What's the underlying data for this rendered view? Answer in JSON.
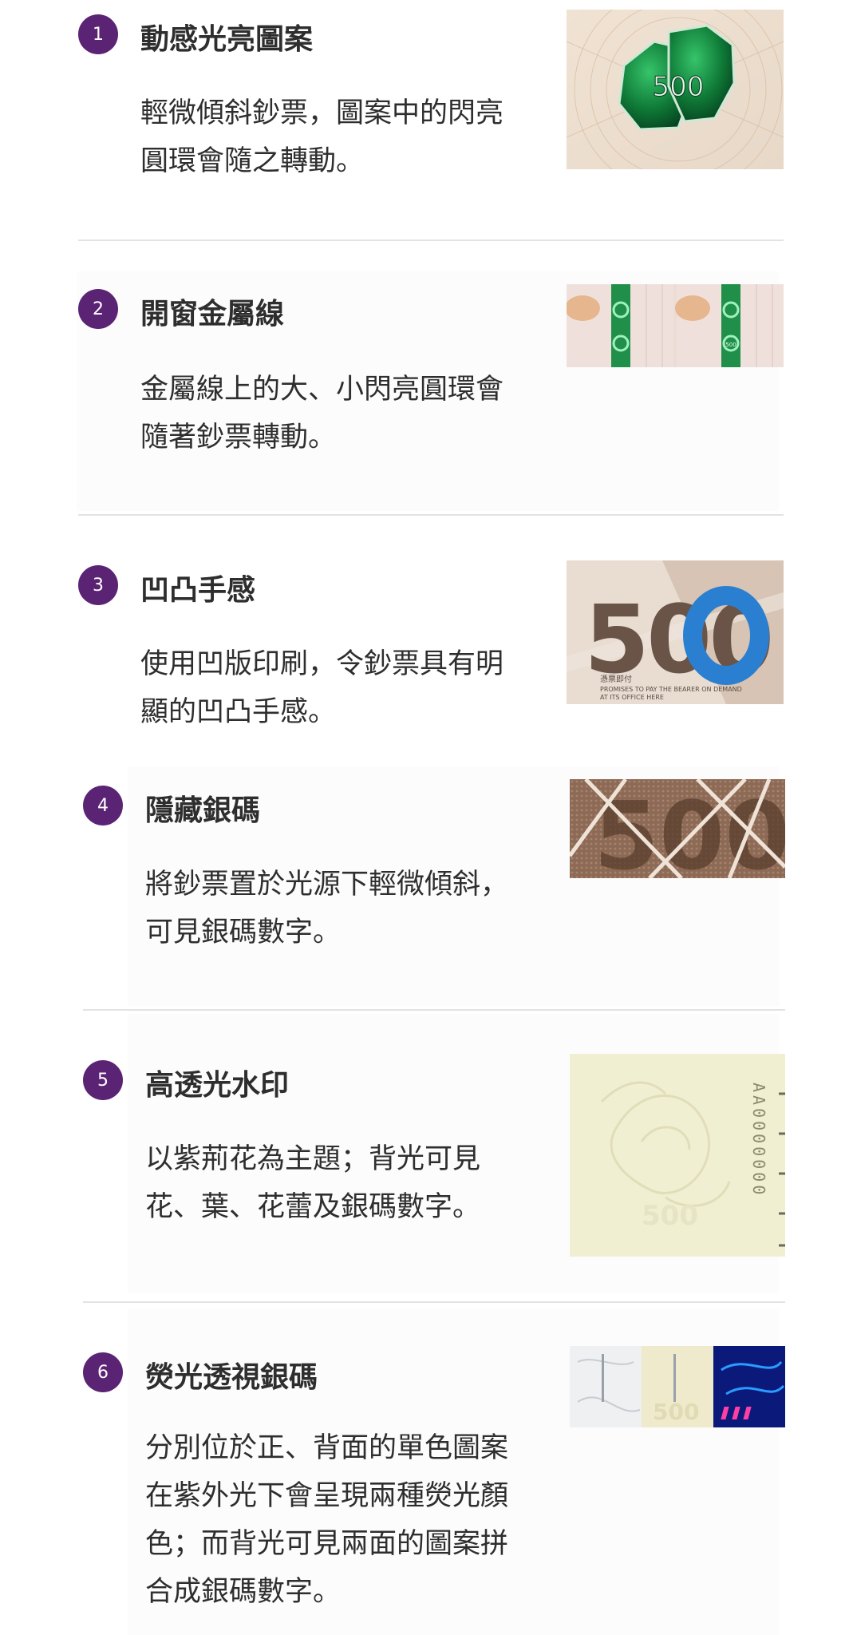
{
  "features": [
    {
      "number": "1",
      "title": "動感光亮圖案",
      "description": "輕微傾斜鈔票，圖案中的閃亮圓環會隨之轉動。",
      "image_text": "500"
    },
    {
      "number": "2",
      "title": "開窗金屬線",
      "description": "金屬線上的大、小閃亮圓環會隨著鈔票轉動。",
      "image_text": "500"
    },
    {
      "number": "3",
      "title": "凹凸手感",
      "description": "使用凹版印刷，令鈔票具有明顯的凹凸手感。",
      "image_text": "500",
      "image_caption_zh": "憑票即付",
      "image_caption_en_1": "PROMISES TO PAY THE BEARER ON DEMAND",
      "image_caption_en_2": "AT ITS OFFICE HERE"
    },
    {
      "number": "4",
      "title": "隱藏銀碼",
      "description": "將鈔票置於光源下輕微傾斜，可見銀碼數字。",
      "image_text": "500"
    },
    {
      "number": "5",
      "title": "高透光水印",
      "description": "以紫荊花為主題；背光可見花、葉、花蕾及銀碼數字。",
      "image_text": "500",
      "serial": "AA0000000"
    },
    {
      "number": "6",
      "title": "熒光透視銀碼",
      "description": "分別位於正、背面的單色圖案在紫外光下會呈現兩種熒光顏色；而背光可見兩面的圖案拼合成銀碼數字。",
      "image_text": "500"
    }
  ]
}
